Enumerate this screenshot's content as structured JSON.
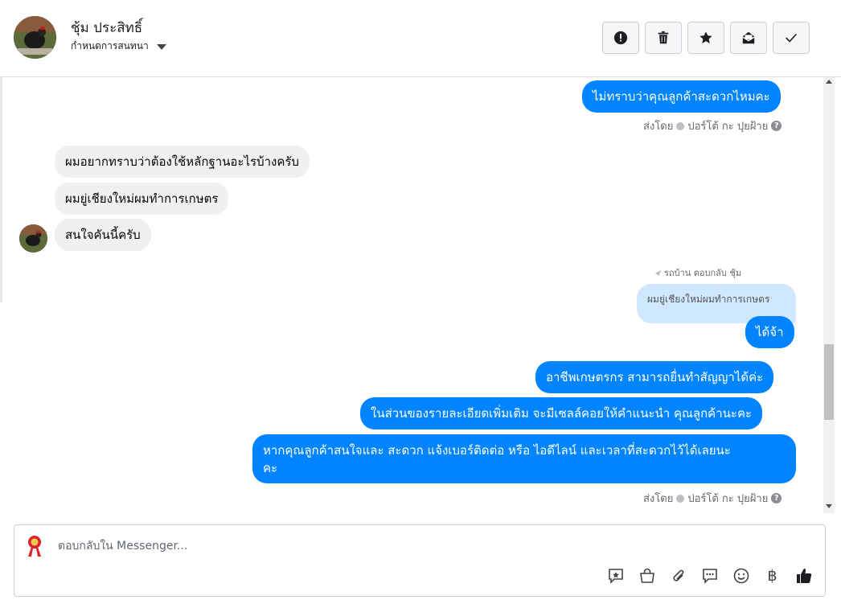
{
  "header": {
    "name": "ชุ้ม ประสิทธิ์",
    "assign_label": "กำหนดการสนทนา",
    "actions": [
      {
        "icon": "alert-icon"
      },
      {
        "icon": "trash-icon"
      },
      {
        "icon": "star-icon"
      },
      {
        "icon": "mark-unread-icon"
      },
      {
        "icon": "check-icon"
      }
    ]
  },
  "messages": {
    "m1": "ไม่ทราบว่าคุณลูกค้าสะดวกไหมคะ",
    "sent_by_1": "ส่งโดย",
    "sender_1": "ปอร์โต้ กะ ปุยฝ้าย",
    "in1": "ผมอยากทราบว่าต้องใช้หลักฐานอะไรบ้างครับ",
    "in2": "ผมยู่เชียงใหม่ผมทำการเกษตร",
    "in3": "สนใจคันนี้ครับ",
    "reply_note": "รถบ้าน ตอบกลับ ชุ้ม",
    "reply_quote": "ผมยู่เชียงใหม่ผมทำการเกษตร",
    "m2": "ได้จ้า",
    "m3": "อาชีพเกษตรกร สามารถยื่นทำสัญญาได้ค่ะ",
    "m4": "ในส่วนของรายละเอียดเพิ่มเติม จะมีเซลล์คอยให้คำแนะนำ คุณลูกค้านะคะ",
    "m5_line1": "หากคุณลูกค้าสนใจและ สะดวก แจ้งเบอร์ติดต่อ หรือ ไอดีไลน์ และเวลาที่สะดวกไว้ได้เลยนะ",
    "m5_line2": "คะ",
    "sent_by_2": "ส่งโดย",
    "sender_2": "ปอร์โต้ กะ ปุยฝ้าย"
  },
  "composer": {
    "placeholder": "ตอบกลับใน Messenger...",
    "tools": [
      "saved-reply-icon",
      "shop-icon",
      "attach-icon",
      "chat-icon",
      "emoji-icon",
      "baht-icon",
      "like-icon"
    ],
    "baht_symbol": "฿"
  },
  "colors": {
    "accent": "#0084ff",
    "incoming_bubble": "#f0f0f0",
    "reply_quote": "#cfe7ff"
  }
}
